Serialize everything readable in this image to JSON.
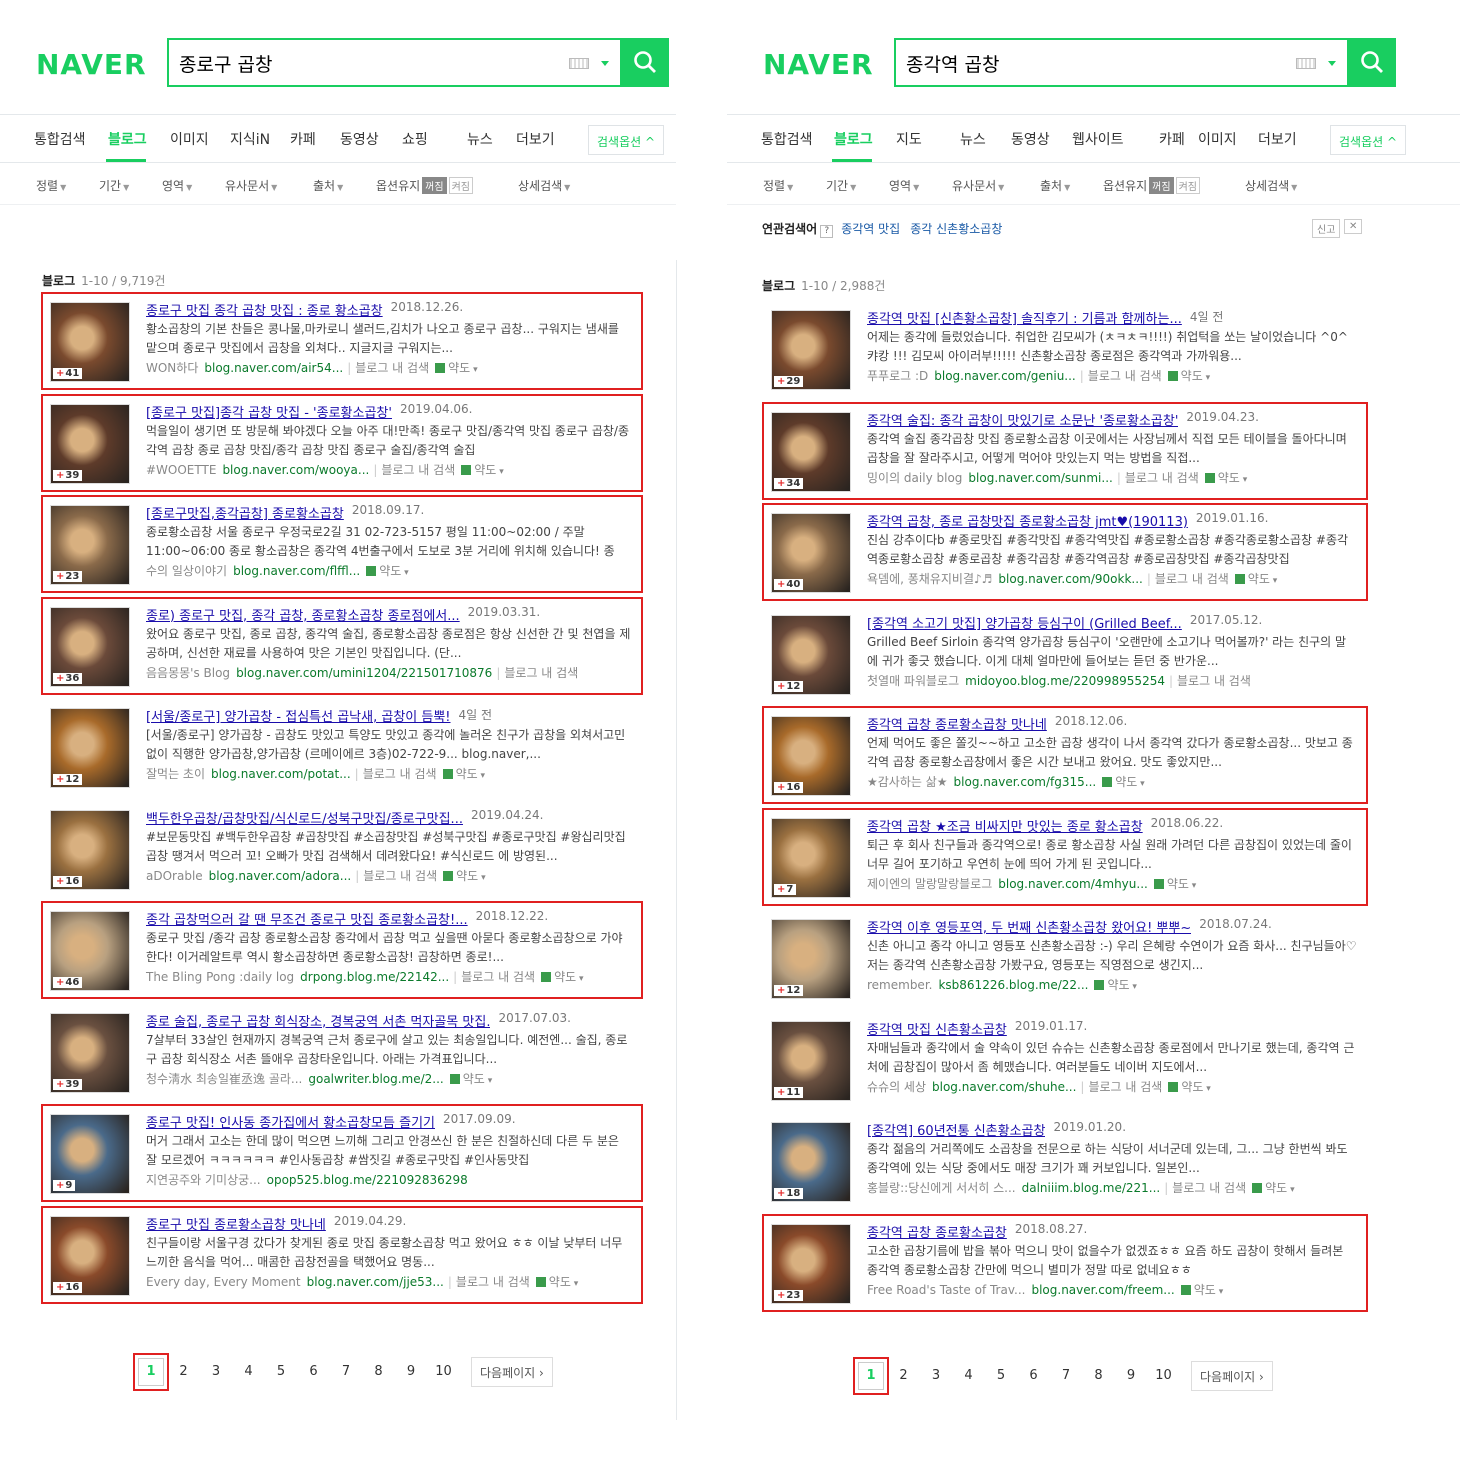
{
  "left": {
    "logo": "NAVER",
    "query": "종로구 곱창",
    "tabs": [
      "통합검색",
      "블로그",
      "이미지",
      "지식iN",
      "카페",
      "동영상",
      "쇼핑",
      "뉴스",
      "더보기"
    ],
    "option_btn": "검색옵션",
    "filters": [
      "정렬",
      "기간",
      "영역",
      "유사문서",
      "출처",
      "옵션유지",
      "상세검색"
    ],
    "toggle_off": "꺼짐",
    "toggle_on": "켜짐",
    "section": {
      "label": "블로그",
      "count": "1-10 / 9,719건"
    },
    "results": [
      {
        "title": "종로구 맛집 종각 곱창 맛집 : 종로 황소곱창",
        "date": "2018.12.26.",
        "desc": "황소곱창의 기본 찬들은 콩나물,마카로니 샐러드,김치가 나오고 종로구 곱창... 구워지는 냄새를 맡으며 종로구 맛집에서 곱창을 외쳐다.. 지글지글 구워지는...",
        "author": "WON하다",
        "url": "blog.naver.com/air54...",
        "inblog": "블로그 내 검색",
        "map": "약도",
        "count": "41"
      },
      {
        "title": "[종로구 맛집]종각 곱창 맛집 - '종로황소곱창'",
        "date": "2019.04.06.",
        "desc": "먹을일이 생기면 또 방문해 봐야겠다 오늘 아주 대!만족! 종로구 맛집/종각역 맛집 종로구 곱창/종각역 곱창 종로 곱창 맛집/종각 곱창 맛집 종로구 술집/종각역 술집",
        "author": "#WOOETTE",
        "url": "blog.naver.com/wooya...",
        "inblog": "블로그 내 검색",
        "map": "약도",
        "count": "39"
      },
      {
        "title": "[종로구맛집,종각곱창] 종로황소곱창",
        "date": "2018.09.17.",
        "desc": "종로황소곱창 서울 종로구 우정국로2길 31 02-723-5157 평일 11:00~02:00 / 주말 11:00~06:00 종로 황소곱창은 종각역 4번출구에서 도보로 3분 거리에 위치해 있습니다! 종로...",
        "author": "수의 일상이야기",
        "url": "blog.naver.com/flffl...",
        "inblog": "",
        "map": "약도",
        "count": "23"
      },
      {
        "title": "종로) 종로구 맛집, 종각 곱창, 종로황소곱창 종로점에서...",
        "date": "2019.03.31.",
        "desc": "왔어요 종로구 맛집, 종로 곱창, 종각역 술집, 종로황소곱창 종로점은 항상 신선한 간 및 천엽을 제공하며, 신선한 재료를 사용하여 맛은 기본인 맛집입니다. (단...",
        "author": "음음몽몽's Blog",
        "url": "blog.naver.com/umini1204/221501710876",
        "inblog": "블로그 내 검색",
        "map": "",
        "count": "36"
      },
      {
        "title": "[서울/종로구] 양가곱창 - 접심특선 곱낙새, 곱창이 듬뿍!",
        "date": "4일 전",
        "desc": "[서울/종로구] 양가곱창 - 곱창도 맛있고 특양도 맛있고 종각에 놀러온 친구가 곱창을 외쳐서고민없이 직행한 양가곱창,양가곱창 (르메이에르 3층)02-722-9... blog.naver,...",
        "author": "잘먹는 초이",
        "url": "blog.naver.com/potat...",
        "inblog": "블로그 내 검색",
        "map": "약도",
        "count": "12"
      },
      {
        "title": "백두한우곱창/곱창맛집/식신로드/성북구맛집/종로구맛집...",
        "date": "2019.04.24.",
        "desc": "#보문동맛집 #백두한우곱창 #곱창맛집 #소곱창맛집 #성북구맛집 #종로구맛집 #왕십리맛집 곱창 땡겨서 먹으러 꼬! 오빠가 맛집 검색해서 데려왔다요! #식신로드 에 방영된...",
        "author": "aDOrable",
        "url": "blog.naver.com/adora...",
        "inblog": "블로그 내 검색",
        "map": "약도",
        "count": "16"
      },
      {
        "title": "종각 곱창먹으러 갈 땐 무조건 종로구 맛집 종로황소곱창!...",
        "date": "2018.12.22.",
        "desc": "종로구 맛집 /종각 곱창 종로황소곱창 종각에서 곱창 먹고 싶을땐 아묻다 종로황소곱창으로 가야한다! 이거레알트루 역시 황소곱창하면 종로황소곱창! 곱창하면 종로!...",
        "author": "The Bling Pong :daily log",
        "url": "drpong.blog.me/22142...",
        "inblog": "블로그 내 검색",
        "map": "약도",
        "count": "46"
      },
      {
        "title": "종로 술집, 종로구 곱창 회식장소, 경복궁역 서촌 먹자골목 맛집.",
        "date": "2017.07.03.",
        "desc": "7살부터 33살인 현재까지 경복궁역 근처 종로구에 살고 있는 최송일입니다. 예전엔... 술집, 종로구 곱창 회식장소 서촌 뜰애우 곱창타운입니다. 아래는 가격표입니다...",
        "author": "청수淸水 최송일崔丞逸 골라...",
        "url": "goalwriter.blog.me/2...",
        "inblog": "",
        "map": "약도",
        "count": "39"
      },
      {
        "title": "종로구 맛집! 인사동 종가집에서 황소곱창모듬 즐기기",
        "date": "2017.09.09.",
        "desc": "머거 그래서 고소는 한데 많이 먹으면 느끼해 그리고 안경쓰신 한 분은 친절하신데 다른 두 분은 잘 모르겠어 ㅋㅋㅋㅋㅋㅋ #인사동곱창 #쌈짓길 #종로구맛집 #인사동맛집",
        "author": "지연공주와 기미상궁...",
        "url": "opop525.blog.me/221092836298",
        "inblog": "",
        "map": "",
        "count": "9"
      },
      {
        "title": "종로구 맛집 종로황소곱창 맛나네",
        "date": "2019.04.29.",
        "desc": "친구들이랑 서울구경 갔다가 찾게된 종로 맛집 종로황소곱창 먹고 왔어요 ㅎㅎ 이날 낮부터 너무 느끼한 음식을 먹어... 매콤한 곱창전골을 택했어요 명동...",
        "author": "Every day, Every Moment",
        "url": "blog.naver.com/jje53...",
        "inblog": "블로그 내 검색",
        "map": "약도",
        "count": "16"
      }
    ],
    "pages": [
      "1",
      "2",
      "3",
      "4",
      "5",
      "6",
      "7",
      "8",
      "9",
      "10"
    ],
    "next": "다음페이지"
  },
  "right": {
    "logo": "NAVER",
    "query": "종각역 곱창",
    "tabs": [
      "통합검색",
      "블로그",
      "지도",
      "뉴스",
      "동영상",
      "웹사이트",
      "카페",
      "이미지",
      "더보기"
    ],
    "option_btn": "검색옵션",
    "filters": [
      "정렬",
      "기간",
      "영역",
      "유사문서",
      "출처",
      "옵션유지",
      "상세검색"
    ],
    "toggle_off": "꺼짐",
    "toggle_on": "켜짐",
    "related_label": "연관검색어",
    "related": [
      "종각역 맛집",
      "종각 신촌황소곱창"
    ],
    "report": "신고",
    "section": {
      "label": "블로그",
      "count": "1-10 / 2,988건"
    },
    "results": [
      {
        "title": "종각역 맛집 [신촌황소곱창] 솔직후기 : 기름과 함께하는...",
        "date": "4일 전",
        "desc": "어제는 종각에 들렀었습니다. 취업한 김모씨가 (ㅊㅋㅊㅋ!!!!) 취업턱을 쏘는 날이었습니다 ^0^ 캬캉 !!! 김모씨 아이러부!!!!! 신촌황소곱창 종로점은 종각역과 가까워용...",
        "author": "푸푸로그 :D",
        "url": "blog.naver.com/geniu...",
        "inblog": "블로그 내 검색",
        "map": "약도",
        "count": "29"
      },
      {
        "title": "종각역 술집: 종각 곱창이 맛있기로 소문난 '종로황소곱창'",
        "date": "2019.04.23.",
        "desc": "종각역 술집 종각곱창 맛집 종로황소곱창 이곳에서는 사장님께서 직접 모든 테이블을 돌아다니며 곱창을 잘 잘라주시고, 어떻게 먹어야 맛있는지 먹는 방법을 직접...",
        "author": "밍이의 daily blog",
        "url": "blog.naver.com/sunmi...",
        "inblog": "블로그 내 검색",
        "map": "약도",
        "count": "34"
      },
      {
        "title": "종각역 곱창, 종로 곱창맛집 종로황소곱창 jmt♥(190113)",
        "date": "2019.01.16.",
        "desc": "진심 강추이다b #종로맛집 #종각맛집 #종각역맛집 #종로황소곱창 #종각종로황소곱창 #종각역종로황소곱창 #종로곱창 #종각곱창 #종각역곱창 #종로곱창맛집 #종각곱창맛집",
        "author": "욕뎀에, 퐁채유지비결♪♬",
        "url": "blog.naver.com/90okk...",
        "inblog": "블로그 내 검색",
        "map": "약도",
        "count": "40"
      },
      {
        "title": "[종각역 소고기 맛집] 양가곱창 등심구이 (Grilled Beef...",
        "date": "2017.05.12.",
        "desc": "Grilled Beef Sirloin 종각역 양가곱창 등심구이 '오랜만에 소고기나 먹어볼까?' 라는 친구의 말에 귀가 좋긋 했습니다. 이게 대체 얼마만에 들어보는 듣던 중 반가운...",
        "author": "첫열매 파워블로그",
        "url": "midoyoo.blog.me/220998955254",
        "inblog": "블로그 내 검색",
        "map": "",
        "count": "12"
      },
      {
        "title": "종각역 곱창 종로황소곱창 맛나네",
        "date": "2018.12.06.",
        "desc": "언제 먹어도 좋은 쫄깃~~하고 고소한 곱창 생각이 나서 종각역 갔다가 종로황소곱창... 맛보고 종각역 곱창 종로황소곱창에서 좋은 시간 보내고 왔어요. 맛도 좋았지만...",
        "author": "★감사하는 삶★",
        "url": "blog.naver.com/fg315...",
        "inblog": "",
        "map": "약도",
        "count": "16"
      },
      {
        "title": "종각역 곱창 ★조금 비싸지만 맛있는 종로 황소곱창",
        "date": "2018.06.22.",
        "desc": "퇴근 후 회사 친구들과 종각역으로! 종로 황소곱창 사실 원래 가려던 다른 곱창집이 있었는데 줄이 너무 길어 포기하고 우연히 눈에 띄어 가게 된 곳입니다...",
        "author": "제이엔의 말랑말랑블로그",
        "url": "blog.naver.com/4mhyu...",
        "inblog": "",
        "map": "약도",
        "count": "7"
      },
      {
        "title": "종각역 이후 영등포역, 두 번째 신촌황소곱창 왔어요! 뿌뿌~",
        "date": "2018.07.24.",
        "desc": "신촌 아니고 종각 아니고 영등포 신촌황소곱창 :-) 우리 은혜랑 수연이가 요즘 화사... 친구님들아♡ 저는 종각역 신촌황소곱창 가봤구요, 영등포는 직영점으로 생긴지...",
        "author": "remember.",
        "url": "ksb861226.blog.me/22...",
        "inblog": "",
        "map": "약도",
        "count": "12"
      },
      {
        "title": "종각역 맛집 신촌황소곱창",
        "date": "2019.01.17.",
        "desc": "자매님들과 종각에서 술 약속이 있던 슈슈는 신촌황소곱창 종로점에서 만나기로 했는데, 종각역 근처에 곱창집이 많아서 좀 헤맸습니다. 여러분들도 네이버 지도에서...",
        "author": "슈슈의 세상",
        "url": "blog.naver.com/shuhe...",
        "inblog": "블로그 내 검색",
        "map": "약도",
        "count": "11"
      },
      {
        "title": "[종각역] 60년전통 신촌황소곱창",
        "date": "2019.01.20.",
        "desc": "종각 젊음의 거리쪽에도 소곱창을 전문으로 하는 식당이 서너군데 있는데, 그... 그냥 한번씩 봐도 종각역에 있는 식당 중에서도 매장 크기가 꽤 커보입니다. 일본인...",
        "author": "홍블랑::당신에게 서서히 스...",
        "url": "dalniiim.blog.me/221...",
        "inblog": "블로그 내 검색",
        "map": "약도",
        "count": "18"
      },
      {
        "title": "종각역 곱창 종로황소곱창",
        "date": "2018.08.27.",
        "desc": "고소한 곱창기름에 밥을 볶아 먹으니 맛이 없을수가 없겠죠ㅎㅎ 요즘 하도 곱창이 핫해서 들려본 종각역 종로황소곱창 간만에 먹으니 별미가 정말 따로 없네요ㅎㅎ",
        "author": "Free Road's Taste of Trav...",
        "url": "blog.naver.com/freem...",
        "inblog": "",
        "map": "약도",
        "count": "23"
      }
    ],
    "pages": [
      "1",
      "2",
      "3",
      "4",
      "5",
      "6",
      "7",
      "8",
      "9",
      "10"
    ],
    "next": "다음페이지"
  },
  "colors": {
    "brand": "#19ce60",
    "highlight_box": "#e02020",
    "link": "#1a0dab",
    "url": "#0b7a2b"
  }
}
